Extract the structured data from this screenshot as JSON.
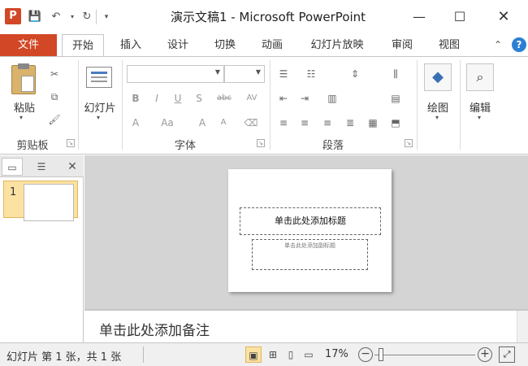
{
  "app": {
    "icon_letter": "P",
    "title": "演示文稿1 - Microsoft PowerPoint",
    "accent_color": "#d24726"
  },
  "quick_access": [
    "save-icon",
    "undo-icon",
    "undo-dropdown-icon",
    "redo-icon",
    "customize-icon"
  ],
  "window_buttons": [
    "minimize-icon",
    "maximize-icon",
    "close-icon"
  ],
  "tabs": [
    "文件",
    "开始",
    "插入",
    "设计",
    "切换",
    "动画",
    "幻灯片放映",
    "审阅",
    "视图"
  ],
  "ribbon": {
    "groups": {
      "clipboard": "剪贴板",
      "font": "字体",
      "paragraph": "段落"
    },
    "paste_label": "粘贴",
    "slide_label": "幻灯片",
    "drawing_label": "绘图",
    "editing_label": "编辑",
    "font_name": "",
    "font_size": ""
  },
  "left_panel": {
    "slide_number": "1"
  },
  "slide": {
    "title_placeholder": "单击此处添加标题",
    "subtitle_placeholder": "单击此处添加副标题"
  },
  "notes": {
    "placeholder": "单击此处添加备注"
  },
  "status": {
    "slide_info": "幻灯片 第 1 张，共 1 张",
    "zoom": "17%",
    "zoom_fraction": 0.06
  }
}
